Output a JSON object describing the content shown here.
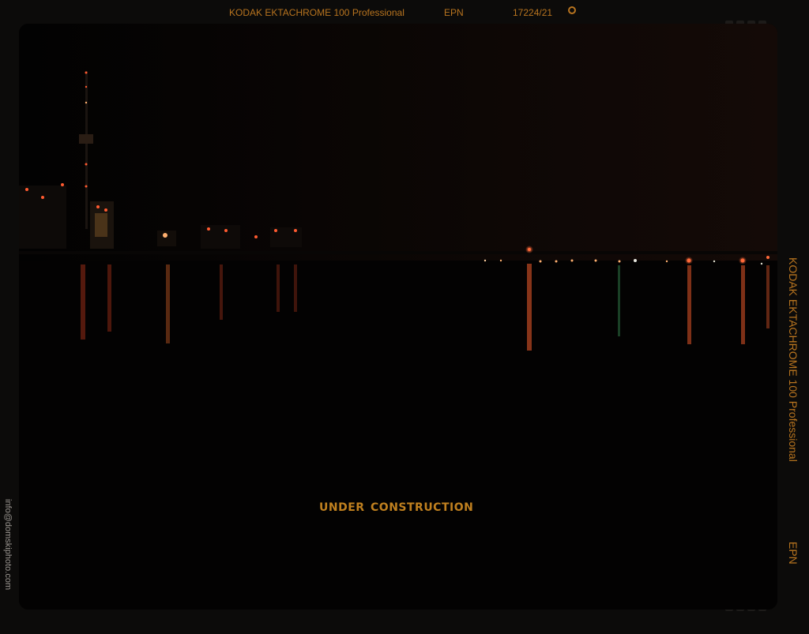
{
  "film_edge": {
    "stock_top": "KODAK EKTACHROME 100 Professional",
    "code_top": "EPN",
    "frame_number": "17224/21",
    "stock_side": "KODAK EKTACHROME 100 Professional",
    "code_side": "EPN",
    "symbol_icon": "film-logo-circle-icon"
  },
  "contact": {
    "email": "info@domskiphoto.com"
  },
  "main": {
    "status": "UNDER CONSTRUCTION"
  },
  "colors": {
    "accent": "#b8741f",
    "background": "#0c0b0a",
    "photo_bg": "#030303",
    "light_orange": "#e0552a"
  }
}
